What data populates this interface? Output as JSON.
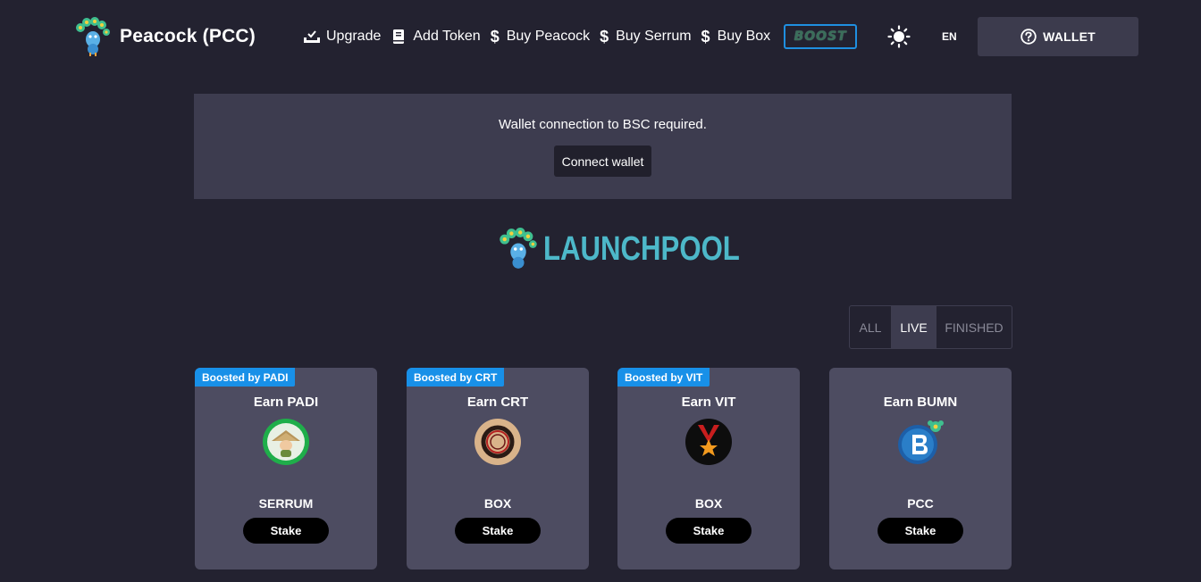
{
  "header": {
    "brand_name": "Peacock (PCC)",
    "nav": [
      {
        "label": "Upgrade",
        "icon": "download-tray-icon"
      },
      {
        "label": "Add Token",
        "icon": "book-icon"
      },
      {
        "label": "Buy Peacock",
        "icon": "dollar-icon"
      },
      {
        "label": "Buy Serrum",
        "icon": "dollar-icon"
      },
      {
        "label": "Buy Box",
        "icon": "dollar-icon"
      }
    ],
    "boost_label": "BOOST",
    "language": "EN",
    "wallet_label": "WALLET"
  },
  "alert": {
    "message": "Wallet connection to BSC required.",
    "button_label": "Connect wallet"
  },
  "launchpool": {
    "title": "LAUNCHPOOL"
  },
  "filters": {
    "tabs": [
      "ALL",
      "LIVE",
      "FINISHED"
    ],
    "active": "LIVE"
  },
  "pools": [
    {
      "badge": "Boosted by PADI",
      "title": "Earn PADI",
      "stake_token": "SERRUM",
      "button": "Stake",
      "icon_color": "#1fae4a"
    },
    {
      "badge": "Boosted by CRT",
      "title": "Earn CRT",
      "stake_token": "BOX",
      "button": "Stake",
      "icon_color": "#d9b38a"
    },
    {
      "badge": "Boosted by VIT",
      "title": "Earn VIT",
      "stake_token": "BOX",
      "button": "Stake",
      "icon_color": "#c81e1e"
    },
    {
      "badge": "",
      "title": "Earn BUMN",
      "stake_token": "PCC",
      "button": "Stake",
      "icon_color": "#1d5fa8"
    }
  ],
  "colors": {
    "background": "#232230",
    "panel": "#3d3c4f",
    "card": "#4d4c61",
    "badge": "#1890e8",
    "launchpool_text": "#4db8c9"
  }
}
